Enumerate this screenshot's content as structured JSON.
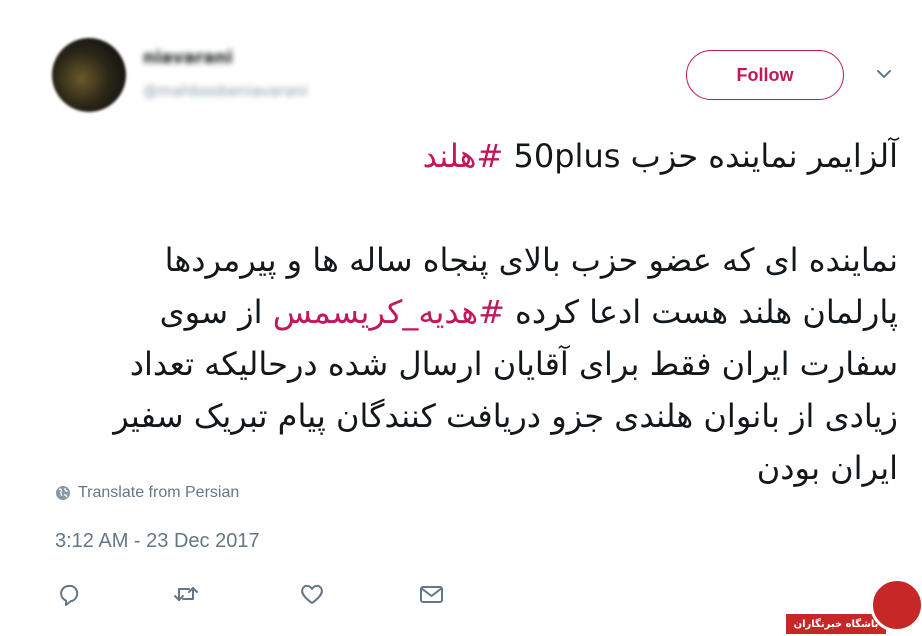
{
  "user": {
    "name": "niavarani",
    "handle": "@mahboobeniavarani"
  },
  "follow_label": "Follow",
  "tweet": {
    "line1_text": "آلزایمر نماینده حزب 50plus ",
    "line1_hashtag": "#هلند",
    "para2_part1": "نماینده ای که عضو حزب بالای پنجاه ساله ها و پیرمردها پارلمان هلند هست ادعا کرده ",
    "para2_hashtag": "#هدیه_کریسمس",
    "para2_part2": " از سوی سفارت ایران فقط برای آقایان ارسال شده درحالیکه تعداد زیادی از بانوان هلندی جزو دریافت کنندگان پیام تبریک سفیر ایران بودن"
  },
  "translate_label": "Translate from Persian",
  "timestamp": "3:12 AM - 23 Dec 2017",
  "watermark_text": "باشگاه خبرنگاران",
  "colors": {
    "accent": "#c2185b",
    "secondary_text": "#657786",
    "icon": "#657786"
  }
}
